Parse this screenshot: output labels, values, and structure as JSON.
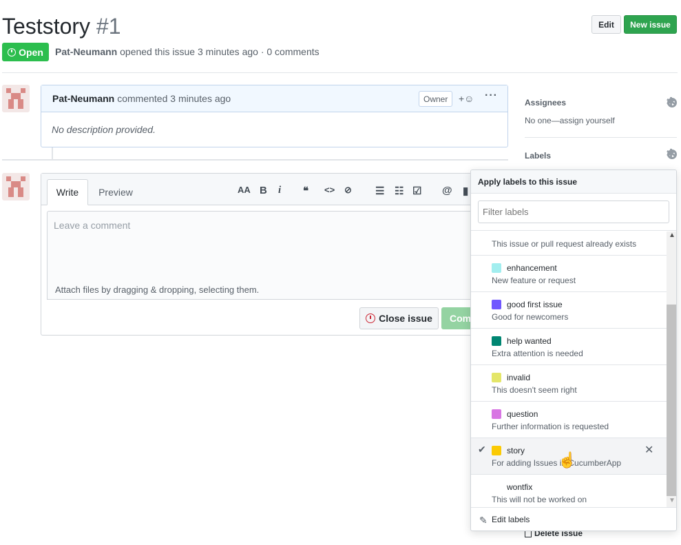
{
  "issue": {
    "title": "Teststory",
    "number": "#1",
    "state": "Open",
    "author": "Pat-Neumann",
    "meta_text": "opened this issue 3 minutes ago · 0 comments"
  },
  "header_buttons": {
    "edit": "Edit",
    "new_issue": "New issue"
  },
  "comment": {
    "author": "Pat-Neumann",
    "time": "commented 3 minutes ago",
    "badge": "Owner",
    "reaction": "+☺",
    "menu": "···",
    "body": "No description provided."
  },
  "composer": {
    "tabs": {
      "write": "Write",
      "preview": "Preview"
    },
    "toolbar": [
      "AA",
      "B",
      "i",
      "❝",
      "<>",
      "⊘",
      "☰",
      "☷",
      "☑",
      "@",
      "▮"
    ],
    "placeholder": "Leave a comment",
    "attach": "Attach files by dragging & dropping, selecting them.",
    "close_issue": "Close issue",
    "comment_btn": "Comment"
  },
  "sidebar": {
    "assignees_label": "Assignees",
    "assignees_value": "No one—assign yourself",
    "labels_label": "Labels",
    "delete_issue": "Delete issue"
  },
  "label_popover": {
    "title": "Apply labels to this issue",
    "filter_placeholder": "Filter labels",
    "items": [
      {
        "name": "",
        "description": "This issue or pull request already exists",
        "color": ""
      },
      {
        "name": "enhancement",
        "description": "New feature or request",
        "color": "#a2eeef"
      },
      {
        "name": "good first issue",
        "description": "Good for newcomers",
        "color": "#7057ff"
      },
      {
        "name": "help wanted",
        "description": "Extra attention is needed",
        "color": "#008672"
      },
      {
        "name": "invalid",
        "description": "This doesn't seem right",
        "color": "#e4e669"
      },
      {
        "name": "question",
        "description": "Further information is requested",
        "color": "#d876e3"
      },
      {
        "name": "story",
        "description": "For adding Issues in CucumberApp",
        "color": "#fbca04",
        "selected": true
      },
      {
        "name": "wontfix",
        "description": "This will not be worked on",
        "color": "#ffffff"
      }
    ],
    "edit_labels": "Edit labels"
  },
  "colors": {
    "green": "#2cbe4e",
    "blue_border": "#c0d3eb"
  }
}
